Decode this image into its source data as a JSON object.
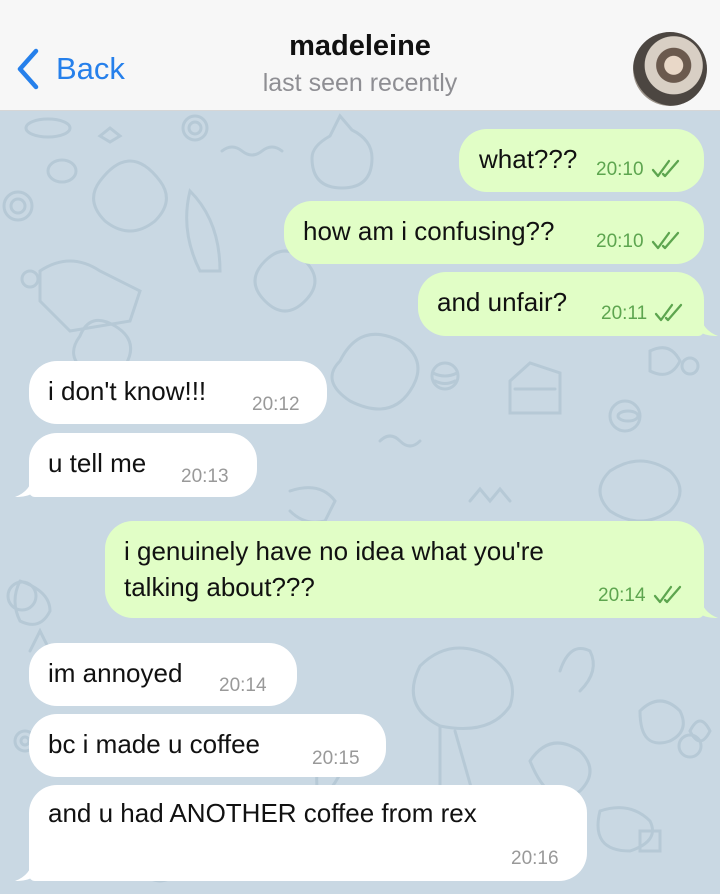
{
  "header": {
    "back_label": "Back",
    "contact_name": "madeleine",
    "status": "last seen recently"
  },
  "colors": {
    "accent": "#2680eb",
    "outgoing_bubble": "#e1fec6",
    "incoming_bubble": "#ffffff",
    "outgoing_time": "#5da54f",
    "incoming_time": "#999999",
    "chat_background": "#c9d8e3"
  },
  "messages": [
    {
      "direction": "outgoing",
      "text": "what???",
      "time": "20:10",
      "read": true
    },
    {
      "direction": "outgoing",
      "text": "how am i confusing??",
      "time": "20:10",
      "read": true
    },
    {
      "direction": "outgoing",
      "text": "and unfair?",
      "time": "20:11",
      "read": true
    },
    {
      "direction": "incoming",
      "text": "i don't know!!!",
      "time": "20:12"
    },
    {
      "direction": "incoming",
      "text": "u tell me",
      "time": "20:13"
    },
    {
      "direction": "outgoing",
      "text": "i genuinely have no idea what you're talking about???",
      "time": "20:14",
      "read": true
    },
    {
      "direction": "incoming",
      "text": "im annoyed",
      "time": "20:14"
    },
    {
      "direction": "incoming",
      "text": "bc i made u coffee",
      "time": "20:15"
    },
    {
      "direction": "incoming",
      "text": "and u had ANOTHER coffee from rex",
      "time": "20:16"
    }
  ],
  "icons": {
    "back": "chevron-left-icon",
    "read_receipt": "double-check-icon"
  }
}
